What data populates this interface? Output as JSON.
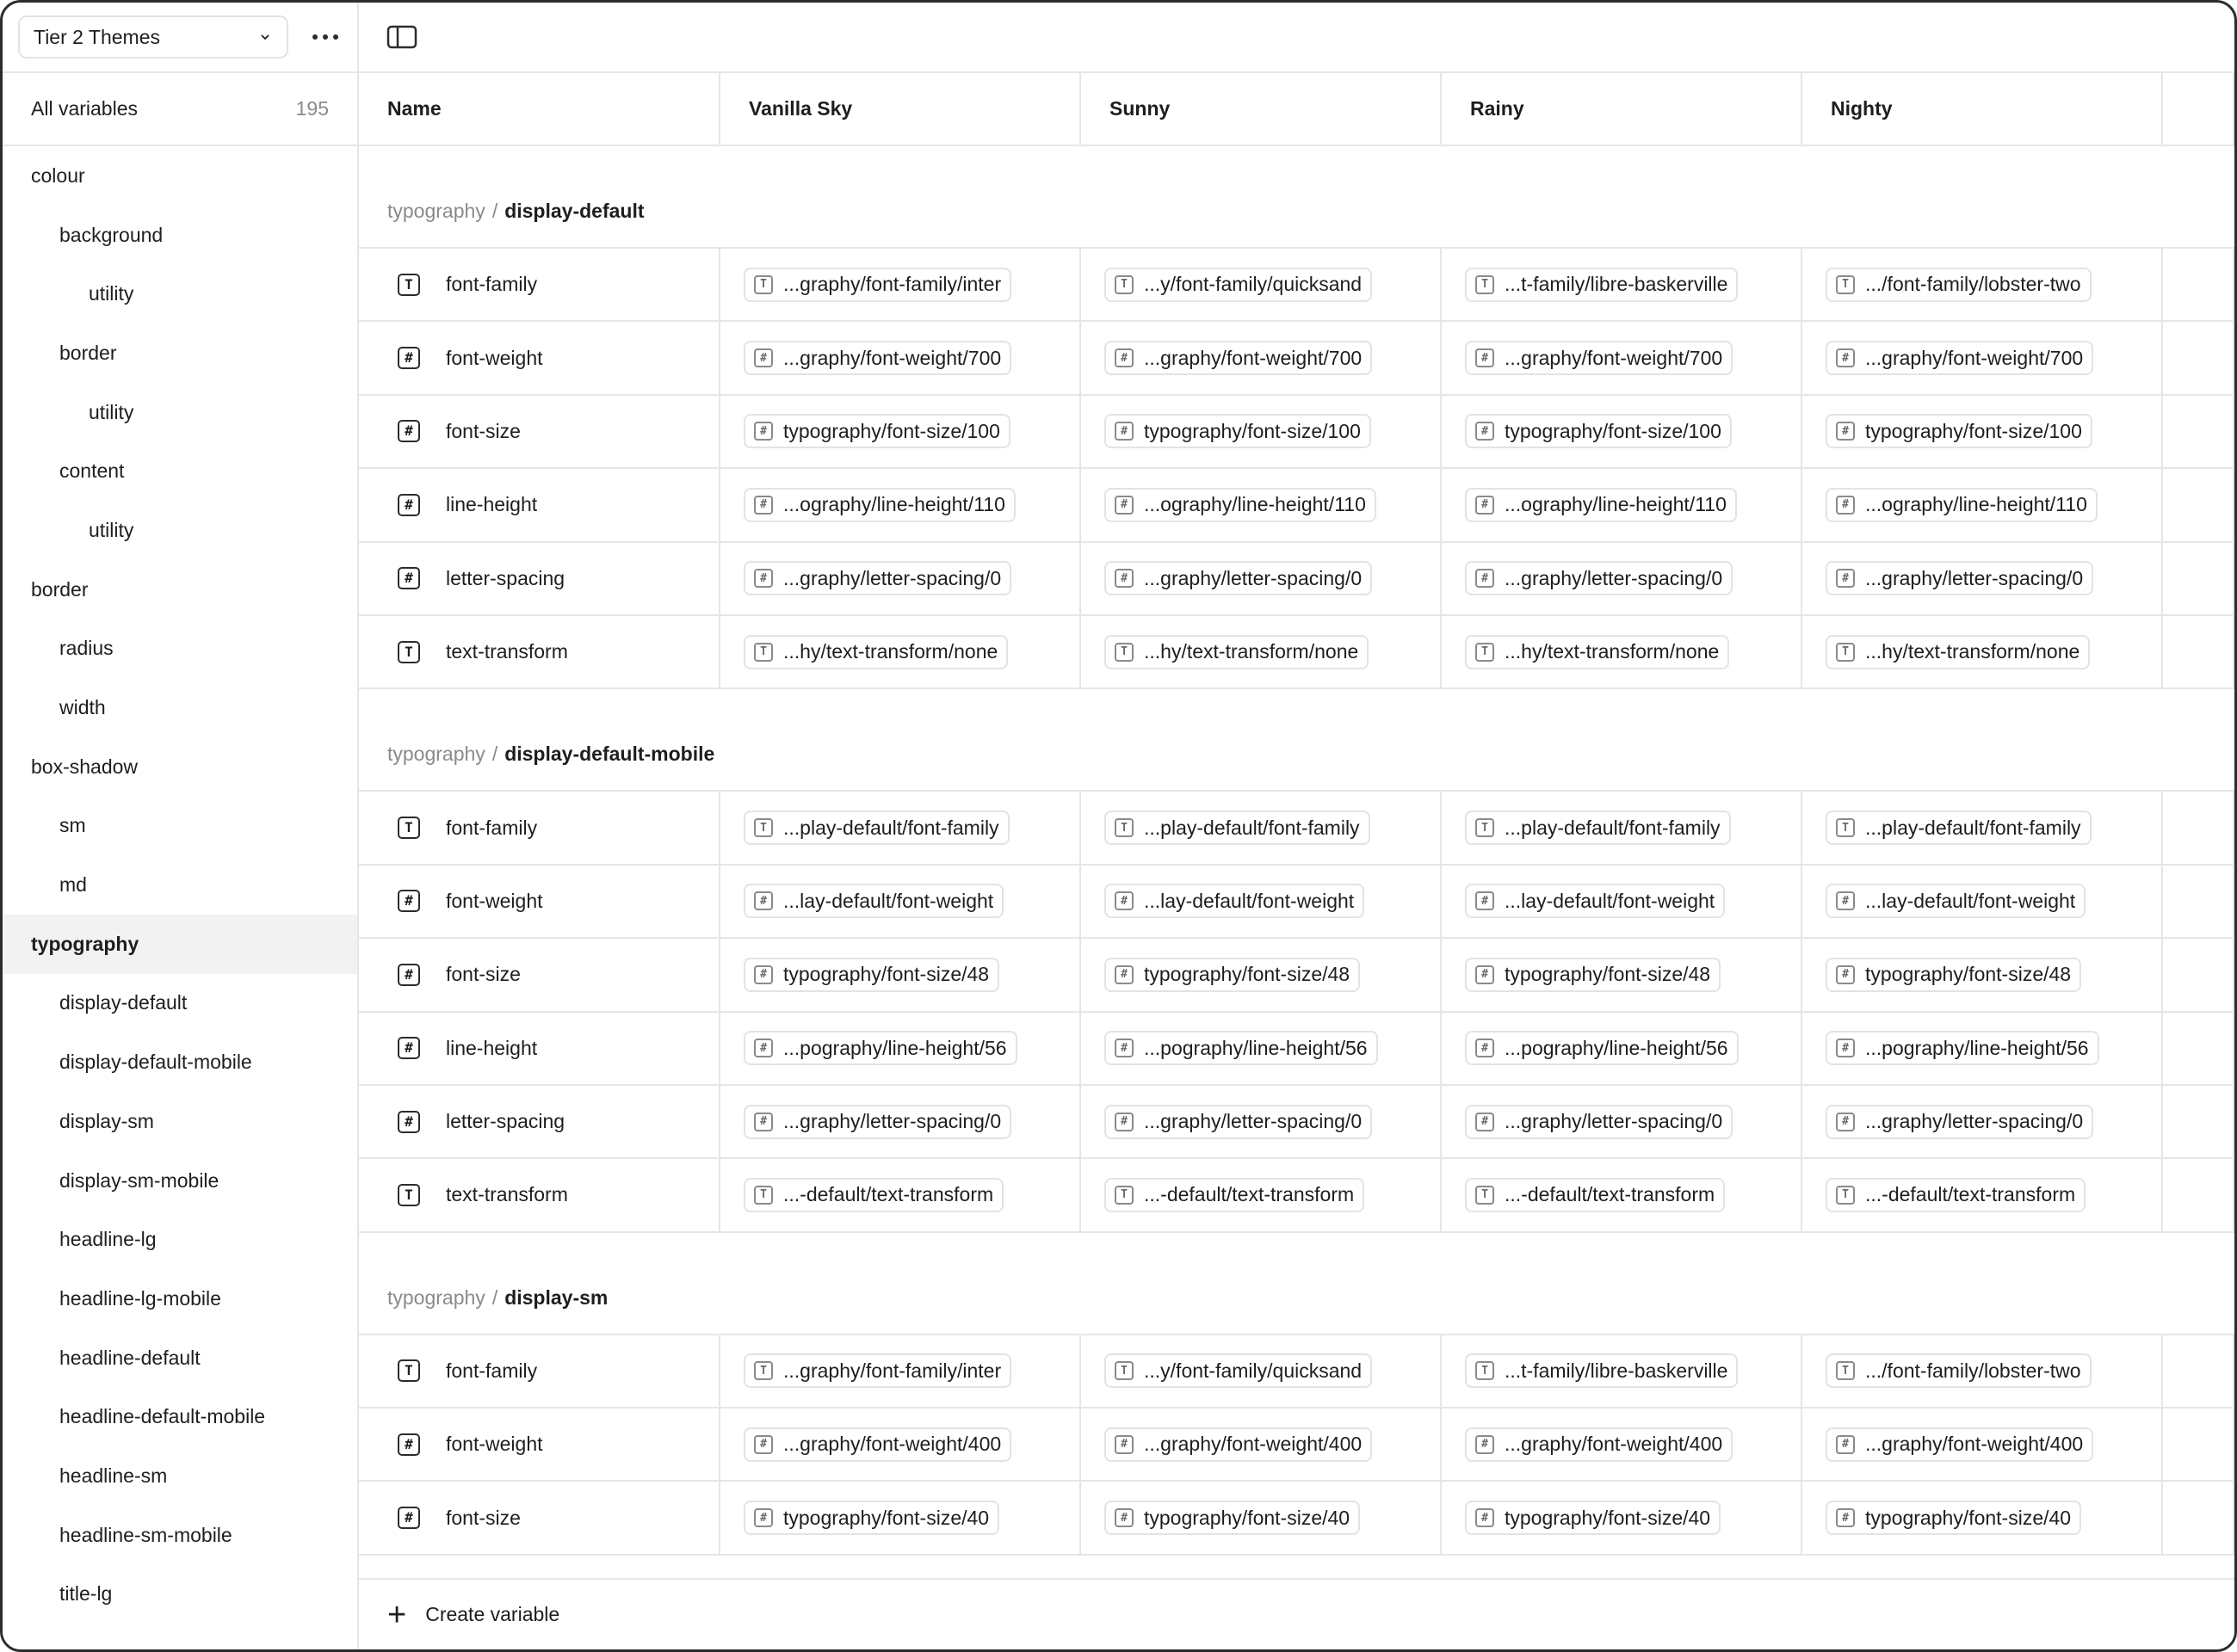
{
  "collection": {
    "name": "Tier 2 Themes"
  },
  "sidebar": {
    "all_variables_label": "All variables",
    "all_variables_count": "195",
    "items": [
      {
        "label": "colour",
        "level": 0
      },
      {
        "label": "background",
        "level": 1
      },
      {
        "label": "utility",
        "level": 2
      },
      {
        "label": "border",
        "level": 1
      },
      {
        "label": "utility",
        "level": 2
      },
      {
        "label": "content",
        "level": 1
      },
      {
        "label": "utility",
        "level": 2
      },
      {
        "label": "border",
        "level": 0
      },
      {
        "label": "radius",
        "level": 1
      },
      {
        "label": "width",
        "level": 1
      },
      {
        "label": "box-shadow",
        "level": 0
      },
      {
        "label": "sm",
        "level": 1
      },
      {
        "label": "md",
        "level": 1
      },
      {
        "label": "typography",
        "level": 0,
        "selected": true
      },
      {
        "label": "display-default",
        "level": 1
      },
      {
        "label": "display-default-mobile",
        "level": 1
      },
      {
        "label": "display-sm",
        "level": 1
      },
      {
        "label": "display-sm-mobile",
        "level": 1
      },
      {
        "label": "headline-lg",
        "level": 1
      },
      {
        "label": "headline-lg-mobile",
        "level": 1
      },
      {
        "label": "headline-default",
        "level": 1
      },
      {
        "label": "headline-default-mobile",
        "level": 1
      },
      {
        "label": "headline-sm",
        "level": 1
      },
      {
        "label": "headline-sm-mobile",
        "level": 1
      },
      {
        "label": "title-lg",
        "level": 1
      }
    ]
  },
  "table": {
    "columns": [
      "Name",
      "Vanilla Sky",
      "Sunny",
      "Rainy",
      "Nighty"
    ],
    "groups": [
      {
        "path": "typography",
        "separator": "/",
        "name": "display-default",
        "rows": [
          {
            "type": "T",
            "name": "font-family",
            "values": [
              "...graphy/font-family/inter",
              "...y/font-family/quicksand",
              "...t-family/libre-baskerville",
              ".../font-family/lobster-two"
            ]
          },
          {
            "type": "#",
            "name": "font-weight",
            "values": [
              "...graphy/font-weight/700",
              "...graphy/font-weight/700",
              "...graphy/font-weight/700",
              "...graphy/font-weight/700"
            ]
          },
          {
            "type": "#",
            "name": "font-size",
            "values": [
              "typography/font-size/100",
              "typography/font-size/100",
              "typography/font-size/100",
              "typography/font-size/100"
            ]
          },
          {
            "type": "#",
            "name": "line-height",
            "values": [
              "...ography/line-height/110",
              "...ography/line-height/110",
              "...ography/line-height/110",
              "...ography/line-height/110"
            ]
          },
          {
            "type": "#",
            "name": "letter-spacing",
            "values": [
              "...graphy/letter-spacing/0",
              "...graphy/letter-spacing/0",
              "...graphy/letter-spacing/0",
              "...graphy/letter-spacing/0"
            ]
          },
          {
            "type": "T",
            "name": "text-transform",
            "values": [
              "...hy/text-transform/none",
              "...hy/text-transform/none",
              "...hy/text-transform/none",
              "...hy/text-transform/none"
            ]
          }
        ]
      },
      {
        "path": "typography",
        "separator": "/",
        "name": "display-default-mobile",
        "rows": [
          {
            "type": "T",
            "name": "font-family",
            "values": [
              "...play-default/font-family",
              "...play-default/font-family",
              "...play-default/font-family",
              "...play-default/font-family"
            ]
          },
          {
            "type": "#",
            "name": "font-weight",
            "values": [
              "...lay-default/font-weight",
              "...lay-default/font-weight",
              "...lay-default/font-weight",
              "...lay-default/font-weight"
            ]
          },
          {
            "type": "#",
            "name": "font-size",
            "values": [
              "typography/font-size/48",
              "typography/font-size/48",
              "typography/font-size/48",
              "typography/font-size/48"
            ]
          },
          {
            "type": "#",
            "name": "line-height",
            "values": [
              "...pography/line-height/56",
              "...pography/line-height/56",
              "...pography/line-height/56",
              "...pography/line-height/56"
            ]
          },
          {
            "type": "#",
            "name": "letter-spacing",
            "values": [
              "...graphy/letter-spacing/0",
              "...graphy/letter-spacing/0",
              "...graphy/letter-spacing/0",
              "...graphy/letter-spacing/0"
            ]
          },
          {
            "type": "T",
            "name": "text-transform",
            "values": [
              "...-default/text-transform",
              "...-default/text-transform",
              "...-default/text-transform",
              "...-default/text-transform"
            ]
          }
        ]
      },
      {
        "path": "typography",
        "separator": "/",
        "name": "display-sm",
        "rows": [
          {
            "type": "T",
            "name": "font-family",
            "values": [
              "...graphy/font-family/inter",
              "...y/font-family/quicksand",
              "...t-family/libre-baskerville",
              ".../font-family/lobster-two"
            ]
          },
          {
            "type": "#",
            "name": "font-weight",
            "values": [
              "...graphy/font-weight/400",
              "...graphy/font-weight/400",
              "...graphy/font-weight/400",
              "...graphy/font-weight/400"
            ]
          },
          {
            "type": "#",
            "name": "font-size",
            "values": [
              "typography/font-size/40",
              "typography/font-size/40",
              "typography/font-size/40",
              "typography/font-size/40"
            ]
          }
        ]
      }
    ]
  },
  "footer": {
    "create_label": "Create variable"
  },
  "icons": {
    "text_type": "text-type-icon",
    "number_type": "number-type-icon",
    "panel": "sidebar-toggle-icon",
    "more": "more-horizontal-icon",
    "chevron": "chevron-down-icon",
    "plus": "plus-icon"
  }
}
